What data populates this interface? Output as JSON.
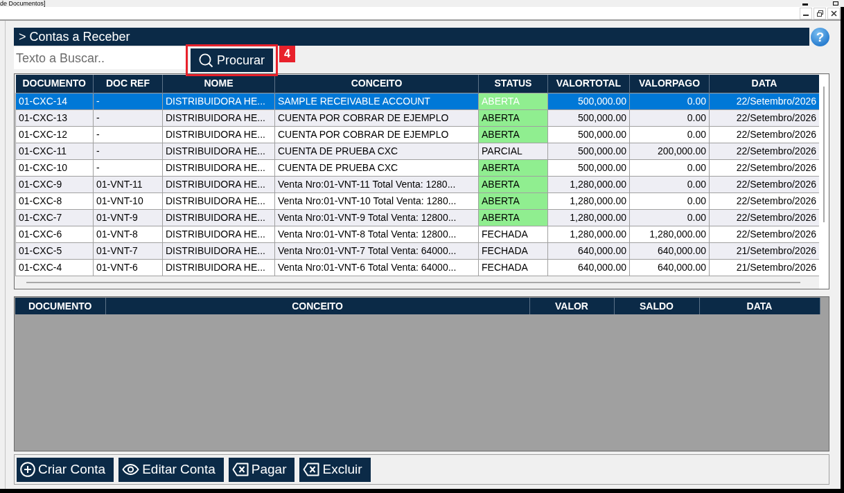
{
  "window": {
    "title": "de Documentos]"
  },
  "panel": {
    "title": "> Contas a Receber",
    "help": "?"
  },
  "search": {
    "placeholder": "Texto a Buscar..",
    "button": "Procurar",
    "annotation": "4"
  },
  "accounts_table": {
    "columns": [
      "DOCUMENTO",
      "DOC REF",
      "NOME",
      "CONCEITO",
      "STATUS",
      "VALORTOTAL",
      "VALORPAGO",
      "DATA"
    ],
    "rows": [
      {
        "selected": true,
        "status_highlighted": true,
        "cells": [
          "01-CXC-14",
          "-",
          "DISTRIBUIDORA HE...",
          "SAMPLE RECEIVABLE ACCOUNT",
          "ABERTA",
          "500,000.00",
          "0.00",
          "22/Setembro/2026"
        ]
      },
      {
        "selected": false,
        "status_highlighted": true,
        "cells": [
          "01-CXC-13",
          "-",
          "DISTRIBUIDORA HE...",
          "CUENTA POR COBRAR DE EJEMPLO",
          "ABERTA",
          "500,000.00",
          "0.00",
          "22/Setembro/2026"
        ]
      },
      {
        "selected": false,
        "status_highlighted": true,
        "cells": [
          "01-CXC-12",
          "-",
          "DISTRIBUIDORA HE...",
          "CUENTA POR COBRAR DE EJEMPLO",
          "ABERTA",
          "500,000.00",
          "0.00",
          "22/Setembro/2026"
        ]
      },
      {
        "selected": false,
        "status_highlighted": false,
        "cells": [
          "01-CXC-11",
          "-",
          "DISTRIBUIDORA HE...",
          "CUENTA DE PRUEBA CXC",
          "PARCIAL",
          "500,000.00",
          "200,000.00",
          "22/Setembro/2026"
        ]
      },
      {
        "selected": false,
        "status_highlighted": true,
        "cells": [
          "01-CXC-10",
          "-",
          "DISTRIBUIDORA HE...",
          "CUENTA DE PRUEBA CXC",
          "ABERTA",
          "500,000.00",
          "0.00",
          "22/Setembro/2026"
        ]
      },
      {
        "selected": false,
        "status_highlighted": true,
        "cells": [
          "01-CXC-9",
          "01-VNT-11",
          "DISTRIBUIDORA HE...",
          "Venta Nro:01-VNT-11 Total Venta: 1280...",
          "ABERTA",
          "1,280,000.00",
          "0.00",
          "22/Setembro/2026"
        ]
      },
      {
        "selected": false,
        "status_highlighted": true,
        "cells": [
          "01-CXC-8",
          "01-VNT-10",
          "DISTRIBUIDORA HE...",
          "Venta Nro:01-VNT-10 Total Venta: 1280...",
          "ABERTA",
          "1,280,000.00",
          "0.00",
          "22/Setembro/2026"
        ]
      },
      {
        "selected": false,
        "status_highlighted": true,
        "cells": [
          "01-CXC-7",
          "01-VNT-9",
          "DISTRIBUIDORA HE...",
          "Venta Nro:01-VNT-9 Total Venta: 12800...",
          "ABERTA",
          "1,280,000.00",
          "0.00",
          "22/Setembro/2026"
        ]
      },
      {
        "selected": false,
        "status_highlighted": false,
        "cells": [
          "01-CXC-6",
          "01-VNT-8",
          "DISTRIBUIDORA HE...",
          "Venta Nro:01-VNT-8 Total Venta: 12800...",
          "FECHADA",
          "1,280,000.00",
          "1,280,000.00",
          "22/Setembro/2026"
        ]
      },
      {
        "selected": false,
        "status_highlighted": false,
        "cells": [
          "01-CXC-5",
          "01-VNT-7",
          "DISTRIBUIDORA HE...",
          "Venta Nro:01-VNT-7 Total Venta: 64000...",
          "FECHADA",
          "640,000.00",
          "640,000.00",
          "21/Setembro/2026"
        ]
      },
      {
        "selected": false,
        "status_highlighted": false,
        "cells": [
          "01-CXC-4",
          "01-VNT-6",
          "DISTRIBUIDORA HE...",
          "Venta Nro:01-VNT-6 Total Venta: 64000...",
          "FECHADA",
          "640,000.00",
          "640,000.00",
          "21/Setembro/2026"
        ]
      }
    ]
  },
  "detail_table": {
    "columns": [
      "DOCUMENTO",
      "CONCEITO",
      "VALOR",
      "SALDO",
      "DATA"
    ]
  },
  "actions": [
    {
      "label": "Criar Conta",
      "kind": "add"
    },
    {
      "label": "Editar Conta",
      "kind": "view"
    },
    {
      "label": "Pagar",
      "kind": "remove"
    },
    {
      "label": "Excluir",
      "kind": "remove"
    }
  ]
}
